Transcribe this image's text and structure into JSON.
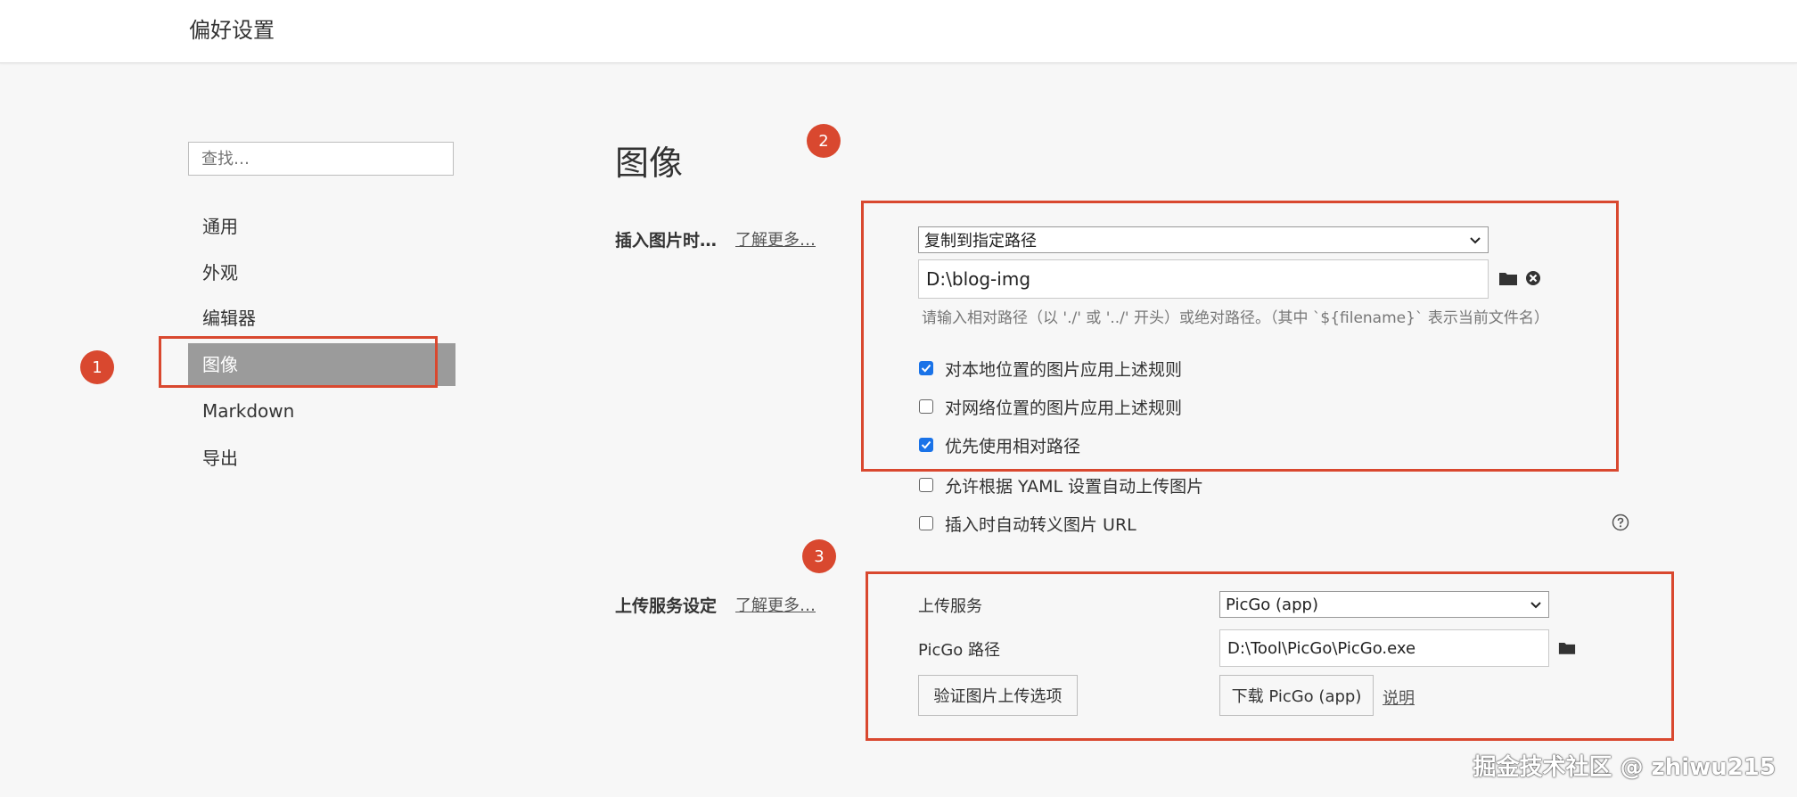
{
  "header": {
    "title": "偏好设置"
  },
  "sidebar": {
    "search_placeholder": "查找…",
    "items": [
      {
        "label": "通用"
      },
      {
        "label": "外观"
      },
      {
        "label": "编辑器"
      },
      {
        "label": "图像",
        "active": true
      },
      {
        "label": "Markdown"
      },
      {
        "label": "导出"
      }
    ]
  },
  "main": {
    "heading": "图像",
    "insert_section": {
      "label": "插入图片时…",
      "learn_more": "了解更多…",
      "action_select": "复制到指定路径",
      "path_value": "D:\\blog-img",
      "hint": "请输入相对路径（以 './' 或 '../' 开头）或绝对路径。（其中 `${filename}` 表示当前文件名）",
      "checkboxes": [
        {
          "label": "对本地位置的图片应用上述规则",
          "checked": true
        },
        {
          "label": "对网络位置的图片应用上述规则",
          "checked": false
        },
        {
          "label": "优先使用相对路径",
          "checked": true
        },
        {
          "label": "允许根据 YAML 设置自动上传图片",
          "checked": false
        },
        {
          "label": "插入时自动转义图片 URL",
          "checked": false
        }
      ]
    },
    "upload_section": {
      "label": "上传服务设定",
      "learn_more": "了解更多…",
      "service_label": "上传服务",
      "service_value": "PicGo (app)",
      "path_label": "PicGo 路径",
      "path_value": "D:\\Tool\\PicGo\\PicGo.exe",
      "verify_button": "验证图片上传选项",
      "download_button": "下载 PicGo (app)",
      "help_link": "说明"
    }
  },
  "annotations": {
    "marker_1": "1",
    "marker_2": "2",
    "marker_3": "3",
    "accent_color": "#d9482f"
  },
  "watermark": "掘金技术社区 @ zhiwu215"
}
